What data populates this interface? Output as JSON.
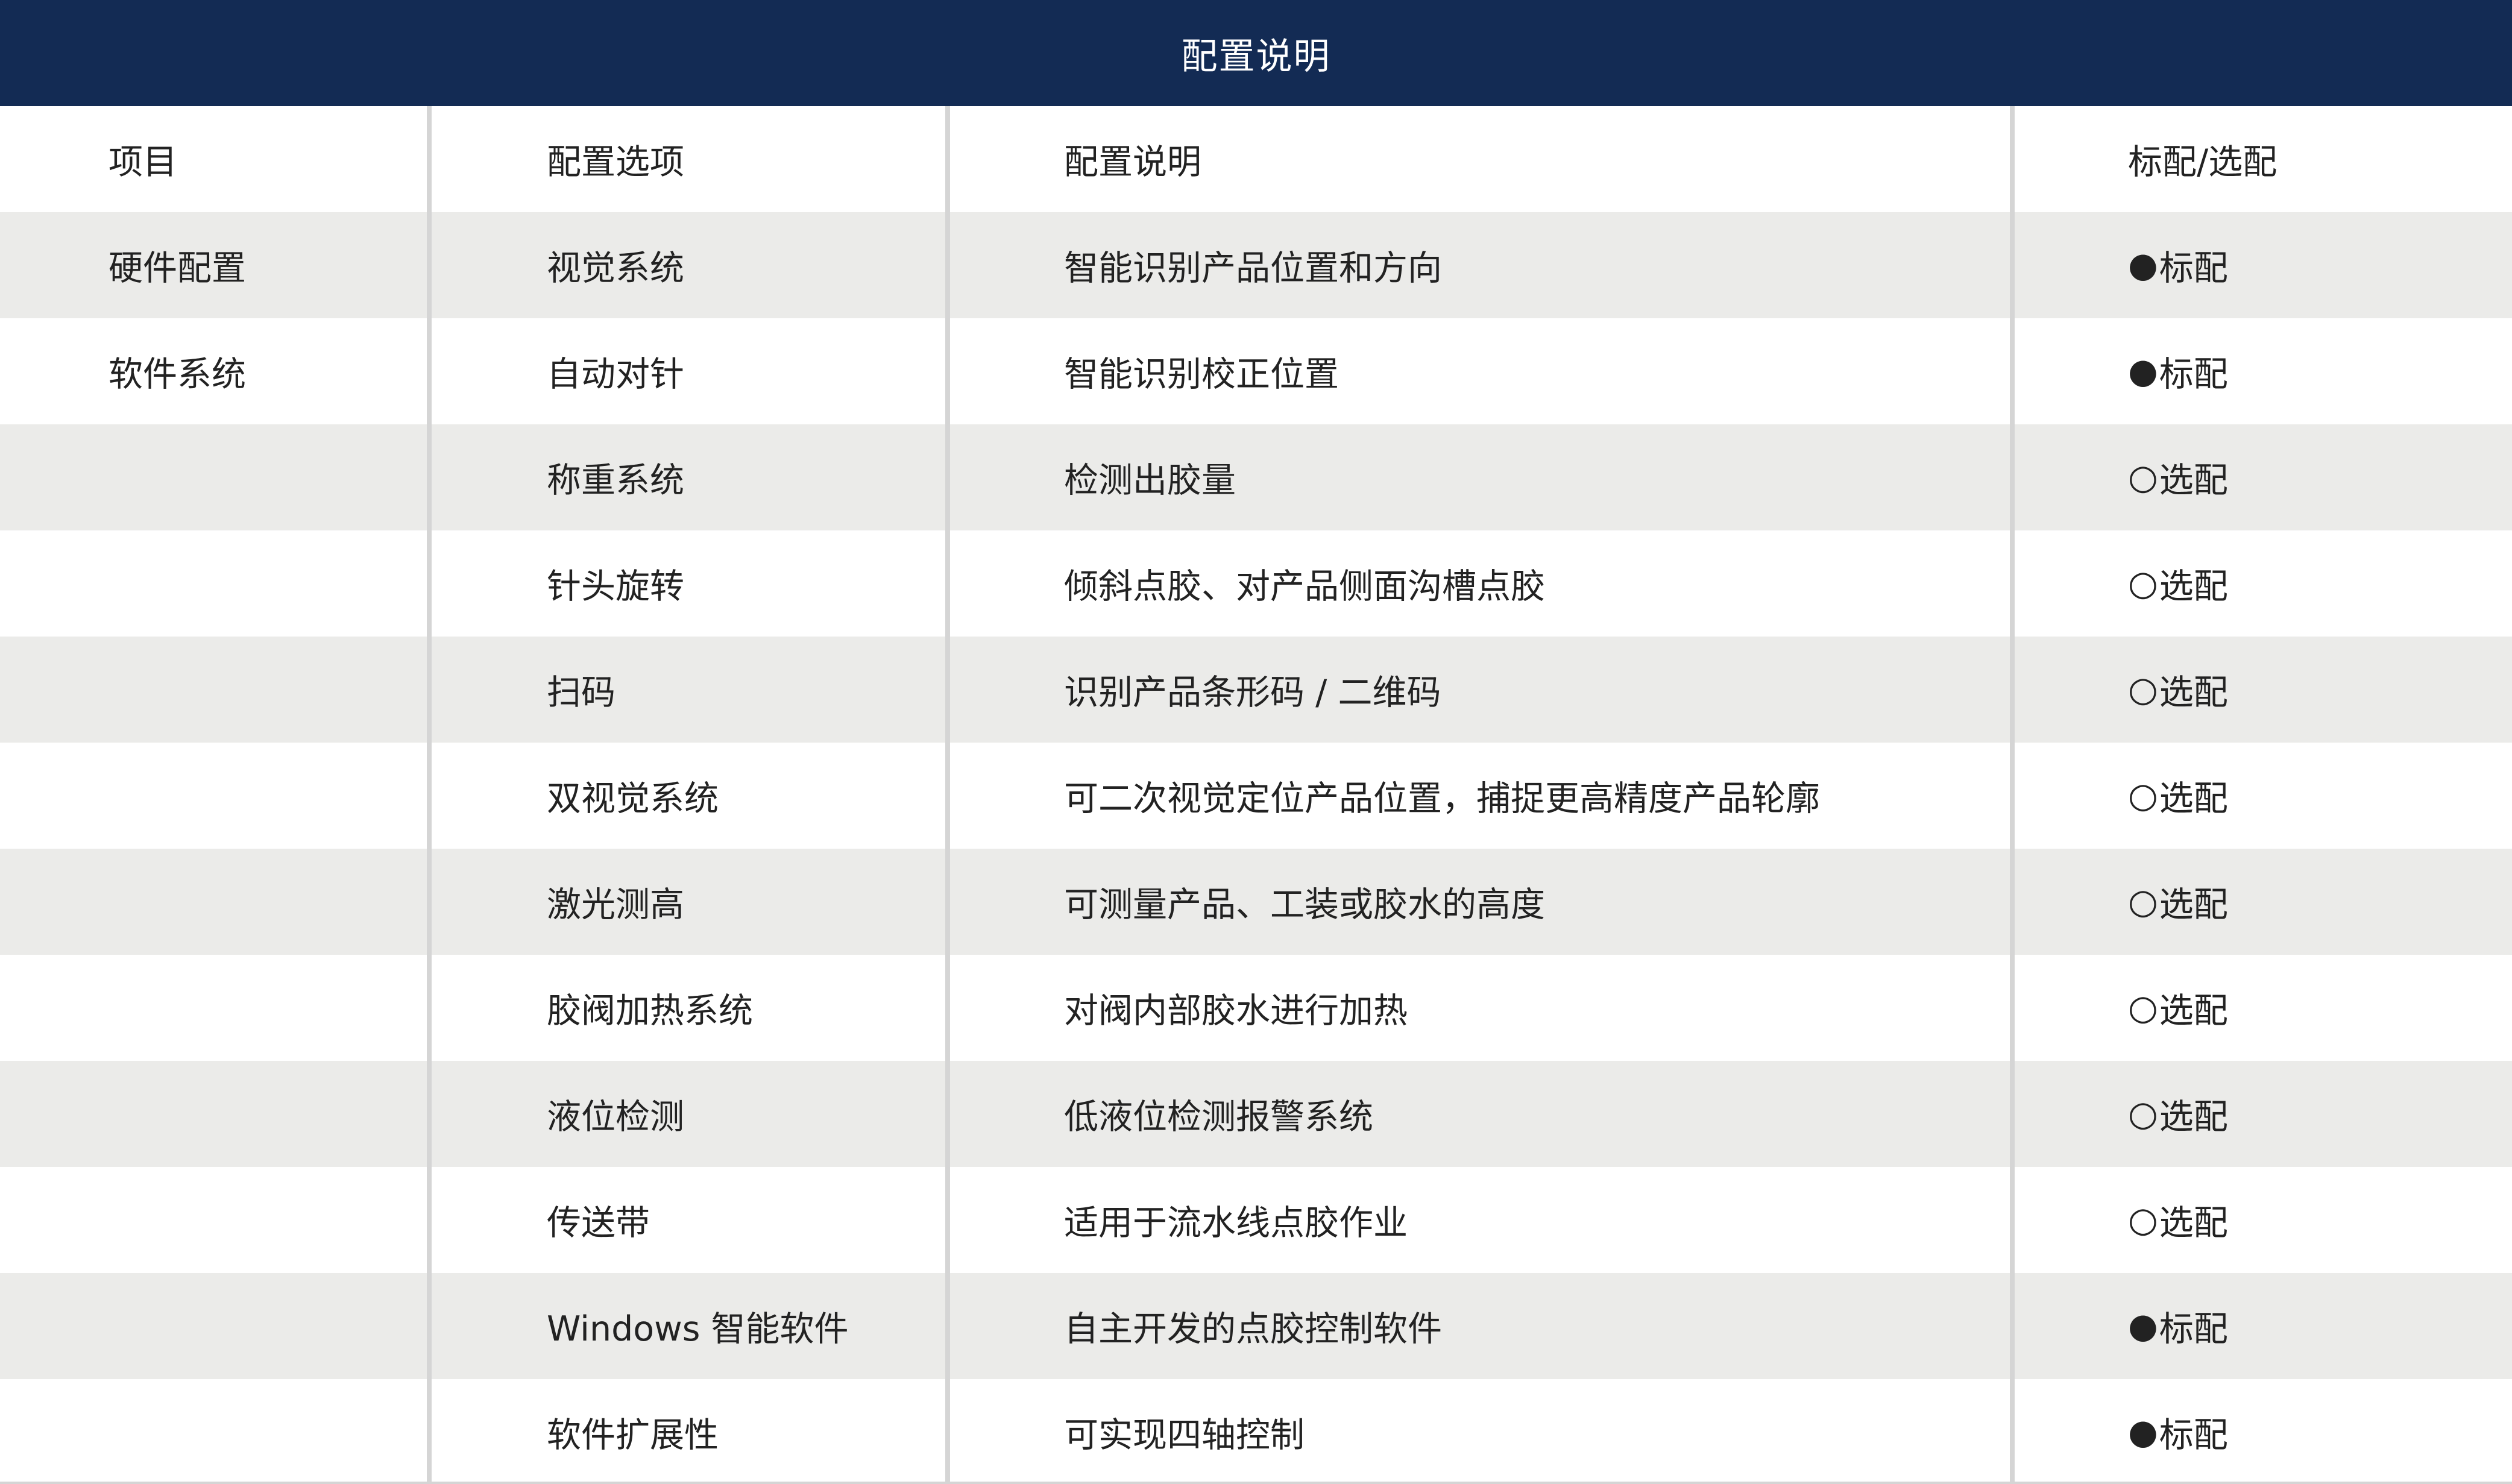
{
  "title": "配置说明",
  "headers": [
    "项目",
    "配置选项",
    "配置说明",
    "标配/选配"
  ],
  "rows": [
    {
      "project": "硬件配置",
      "option": "视觉系统",
      "description": "智能识别产品位置和方向",
      "symbol": "●",
      "type": "标配"
    },
    {
      "project": "软件系统",
      "option": "自动对针",
      "description": "智能识别校正位置",
      "symbol": "●",
      "type": "标配"
    },
    {
      "project": "",
      "option": "称重系统",
      "description": "检测出胶量",
      "symbol": "○",
      "type": "选配"
    },
    {
      "project": "",
      "option": "针头旋转",
      "description": "倾斜点胶、对产品侧面沟槽点胶",
      "symbol": "○",
      "type": "选配"
    },
    {
      "project": "",
      "option": "扫码",
      "description": "识别产品条形码 / 二维码",
      "symbol": "○",
      "type": "选配"
    },
    {
      "project": "",
      "option": "双视觉系统",
      "description": "可二次视觉定位产品位置，捕捉更高精度产品轮廓",
      "symbol": "○",
      "type": "选配"
    },
    {
      "project": "",
      "option": "激光测高",
      "description": "可测量产品、工装或胶水的高度",
      "symbol": "○",
      "type": "选配"
    },
    {
      "project": "",
      "option": "胶阀加热系统",
      "description": "对阀内部胶水进行加热",
      "symbol": "○",
      "type": "选配"
    },
    {
      "project": "",
      "option": "液位检测",
      "description": "低液位检测报警系统",
      "symbol": "○",
      "type": "选配"
    },
    {
      "project": "",
      "option": "传送带",
      "description": "适用于流水线点胶作业",
      "symbol": "○",
      "type": "选配"
    },
    {
      "project": "",
      "option": "Windows 智能软件",
      "description": "自主开发的点胶控制软件",
      "symbol": "●",
      "type": "标配"
    },
    {
      "project": "",
      "option": "软件扩展性",
      "description": "可实现四轴控制",
      "symbol": "●",
      "type": "标配"
    }
  ]
}
